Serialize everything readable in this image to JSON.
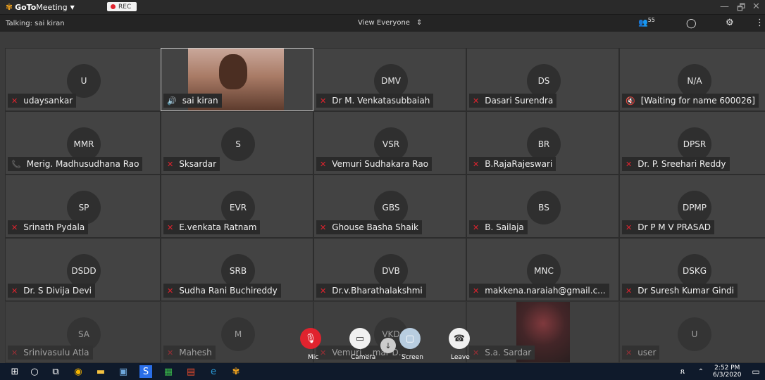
{
  "app": {
    "name_part1": "GoTo",
    "name_part2": "Meeting",
    "rec_label": "REC"
  },
  "window": {
    "minimize": "—",
    "restore": "🗗",
    "close": "✕"
  },
  "infobar": {
    "talking": "Talking: sai kiran",
    "view": "View Everyone",
    "participant_count": "55"
  },
  "tiles": [
    {
      "initials": "U",
      "name": "udaysankar",
      "status": "muted"
    },
    {
      "initials": "",
      "name": "sai kiran",
      "status": "speaking",
      "video": true
    },
    {
      "initials": "DMV",
      "name": "Dr M. Venkatasubbaiah",
      "status": "muted"
    },
    {
      "initials": "DS",
      "name": "Dasari Surendra",
      "status": "muted"
    },
    {
      "initials": "N/A",
      "name": "[Waiting for name 600026]",
      "status": "speaker-off"
    },
    {
      "initials": "MMR",
      "name": "Merig. Madhusudhana Rao",
      "status": "phone"
    },
    {
      "initials": "S",
      "name": "Sksardar",
      "status": "muted"
    },
    {
      "initials": "VSR",
      "name": "Vemuri Sudhakara Rao",
      "status": "muted"
    },
    {
      "initials": "BR",
      "name": "B.RajaRajeswari",
      "status": "muted"
    },
    {
      "initials": "DPSR",
      "name": "Dr. P. Sreehari Reddy",
      "status": "muted"
    },
    {
      "initials": "SP",
      "name": "Srinath Pydala",
      "status": "muted"
    },
    {
      "initials": "EVR",
      "name": "E.venkata Ratnam",
      "status": "muted"
    },
    {
      "initials": "GBS",
      "name": "Ghouse Basha Shaik",
      "status": "muted"
    },
    {
      "initials": "BS",
      "name": "B. Sailaja",
      "status": "muted"
    },
    {
      "initials": "DPMP",
      "name": "Dr P M V PRASAD",
      "status": "muted"
    },
    {
      "initials": "DSDD",
      "name": "Dr. S Divija Devi",
      "status": "muted"
    },
    {
      "initials": "SRB",
      "name": "Sudha Rani Buchireddy",
      "status": "muted"
    },
    {
      "initials": "DVB",
      "name": "Dr.v.Bharathalakshmi",
      "status": "muted"
    },
    {
      "initials": "MNC",
      "name": "makkena.naraiah@gmail.c...",
      "status": "muted"
    },
    {
      "initials": "DSKG",
      "name": "Dr Suresh Kumar Gindi",
      "status": "muted"
    },
    {
      "initials": "SA",
      "name": "Srinivasulu Atla",
      "status": "muted"
    },
    {
      "initials": "M",
      "name": "Mahesh",
      "status": "muted"
    },
    {
      "initials": "VKD",
      "name": "Vemuri ...mar D...",
      "status": "muted"
    },
    {
      "initials": "",
      "name": "S.a. Sardar",
      "status": "muted",
      "video": true
    },
    {
      "initials": "U",
      "name": "user",
      "status": "muted"
    }
  ],
  "controls": {
    "mic": "Mic",
    "camera": "Camera",
    "screen": "Screen",
    "leave": "Leave"
  },
  "taskbar": {
    "time": "2:52 PM",
    "date": "6/3/2020"
  },
  "colors": {
    "muted_red": "#e0232e",
    "speaking_green": "#41c463",
    "brand_orange": "#f7a61d"
  }
}
